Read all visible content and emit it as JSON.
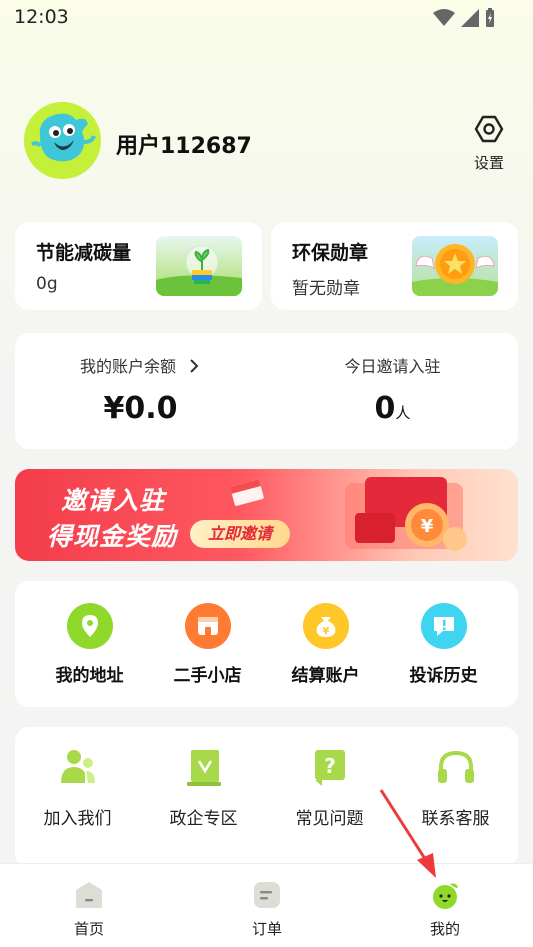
{
  "status_bar": {
    "time": "12:03"
  },
  "profile": {
    "username": "用户112687",
    "settings_label": "设置"
  },
  "stats": [
    {
      "title": "节能减碳量",
      "value": "0g"
    },
    {
      "title": "环保勋章",
      "value": "暂无勋章"
    }
  ],
  "balance": {
    "left_label": "我的账户余额",
    "left_value": "¥0.0",
    "right_label": "今日邀请入驻",
    "right_value": "0",
    "right_unit": "人"
  },
  "banner": {
    "line1": "邀请入驻",
    "line2": "得现金奖励",
    "button": "立即邀请"
  },
  "quick_actions": [
    {
      "label": "我的地址",
      "icon": "location-icon",
      "color": "#8fd92a"
    },
    {
      "label": "二手小店",
      "icon": "shop-icon",
      "color": "#ff7a32"
    },
    {
      "label": "结算账户",
      "icon": "money-bag-icon",
      "color": "#ffc727"
    },
    {
      "label": "投诉历史",
      "icon": "complaint-icon",
      "color": "#3fd4f0"
    }
  ],
  "services": [
    {
      "label": "加入我们",
      "icon": "join-us-icon"
    },
    {
      "label": "政企专区",
      "icon": "enterprise-icon"
    },
    {
      "label": "常见问题",
      "icon": "faq-icon"
    },
    {
      "label": "联系客服",
      "icon": "headset-icon"
    }
  ],
  "tabbar": [
    {
      "label": "首页",
      "icon": "home-icon"
    },
    {
      "label": "订单",
      "icon": "order-icon"
    },
    {
      "label": "我的",
      "icon": "profile-icon",
      "active": true
    }
  ],
  "colors": {
    "accent_green": "#8fd92a",
    "banner_red": "#f33d4a"
  }
}
